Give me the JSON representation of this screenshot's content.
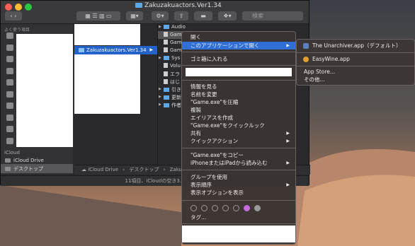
{
  "window": {
    "title": "Zakuzakuactors.Ver1.34",
    "search_placeholder": "検索",
    "status": "11項目、iCloudの空き3..."
  },
  "sidebar": {
    "header": "よく使う項目",
    "icloud_header": "iCloud",
    "items": [
      {
        "label": "iCloud Drive"
      },
      {
        "label": "デスクトップ"
      }
    ]
  },
  "column1": {
    "selected": "Zakuzakuactors.Ver1.34"
  },
  "column2": {
    "rows": [
      "Audio",
      "Gam",
      "Gam",
      "Gam",
      "Sys",
      "Volu",
      "エラ",
      "はじ",
      "引き",
      "更新",
      "作者"
    ]
  },
  "pathbar": {
    "segments": [
      "iCloud Drive",
      "デスクトップ",
      "Zakus"
    ]
  },
  "context_menu": {
    "open": "開く",
    "open_with": "このアプリケーションで開く",
    "trash": "ゴミ箱に入れる",
    "get_info": "情報を見る",
    "rename": "名前を変更",
    "compress": "\"Game.exe\"を圧縮",
    "duplicate": "複製",
    "make_alias": "エイリアスを作成",
    "quick_look": "\"Game.exe\"をクイックルック",
    "share": "共有",
    "quick_actions": "クイックアクション",
    "copy": "\"Game.exe\"をコピー",
    "import": "iPhoneまたはiPadから読み込む",
    "use_groups": "グループを使用",
    "sort_by": "表示順序",
    "view_options": "表示オプションを表示",
    "tags": "タグ...",
    "tag_colors": [
      "#777",
      "#777",
      "#777",
      "#777",
      "#777",
      "#c66be0",
      "#9a9a9a"
    ]
  },
  "submenu": {
    "items": [
      "The Unarchiver.app（デフォルト）",
      "EasyWine.app",
      "App Store...",
      "その他..."
    ]
  },
  "colors": {
    "accent": "#2f6fd6"
  }
}
